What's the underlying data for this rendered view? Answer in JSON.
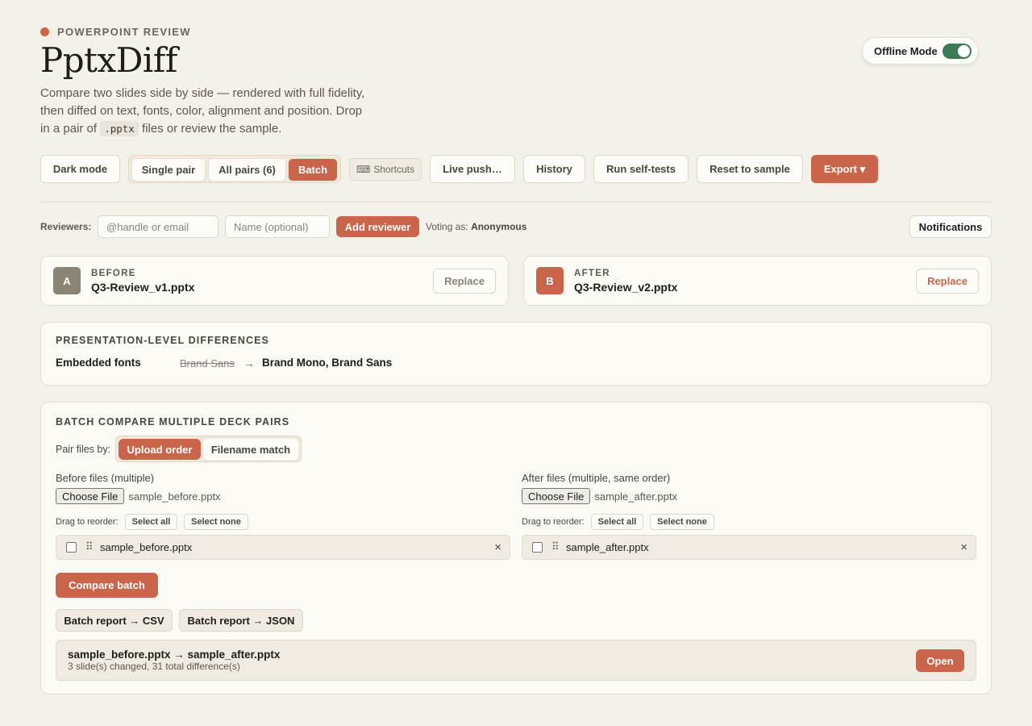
{
  "header": {
    "eyebrow": "POWERPOINT REVIEW",
    "title": "PptxDiff",
    "subtitle_before": "Compare two slides side by side — rendered with full fidelity, then diffed on text, fonts, color, alignment and position. Drop in a pair of ",
    "subtitle_code": ".pptx",
    "subtitle_after": " files or review the sample.",
    "offline_label": "Offline Mode",
    "offline_on": true
  },
  "toolbar": {
    "dark_mode": "Dark mode",
    "single_pair": "Single pair",
    "all_pairs": "All pairs (6)",
    "batch": "Batch",
    "active_view": "Batch",
    "shortcuts": "Shortcuts",
    "live_push": "Live push…",
    "history": "History",
    "self_tests": "Run self-tests",
    "reset": "Reset to sample",
    "export": "Export ▾"
  },
  "reviewers": {
    "label": "Reviewers:",
    "handle_placeholder": "@handle or email",
    "name_placeholder": "Name (optional)",
    "add_button": "Add reviewer",
    "voting_prefix": "Voting as:",
    "voting_name": "Anonymous",
    "notifications": "Notifications"
  },
  "files": {
    "before": {
      "badge": "A",
      "kicker": "BEFORE",
      "name": "Q3-Review_v1.pptx",
      "replace": "Replace",
      "color": "#8a8474"
    },
    "after": {
      "badge": "B",
      "kicker": "AFTER",
      "name": "Q3-Review_v2.pptx",
      "replace": "Replace",
      "color": "#c9654a"
    }
  },
  "presentation_diff": {
    "title": "PRESENTATION-LEVEL DIFFERENCES",
    "row_label": "Embedded fonts",
    "old_value": "Brand Sans",
    "arrow": "→",
    "new_value": "Brand Mono, Brand Sans"
  },
  "batch": {
    "title": "BATCH COMPARE MULTIPLE DECK PAIRS",
    "pair_label": "Pair files by:",
    "upload_order": "Upload order",
    "filename_match": "Filename match",
    "active_mode": "Upload order",
    "before_label": "Before files (multiple)",
    "after_label": "After files (multiple, same order)",
    "choose_file": "Choose File",
    "before_chosen": "sample_before.pptx",
    "after_chosen": "sample_after.pptx",
    "drag_label": "Drag to reorder:",
    "select_all": "Select all",
    "select_none": "Select none",
    "before_list": [
      "sample_before.pptx"
    ],
    "after_list": [
      "sample_after.pptx"
    ],
    "remove_glyph": "×",
    "compare_button": "Compare batch",
    "csv_button": "Batch report → CSV",
    "json_button": "Batch report → JSON",
    "result_title": "sample_before.pptx → sample_after.pptx",
    "result_summary": "3 slide(s) changed, 31 total difference(s)",
    "open_button": "Open"
  },
  "colors": {
    "accent": "#c9654a",
    "toggle_on": "#3b7a57",
    "background": "#f4f1ea"
  }
}
